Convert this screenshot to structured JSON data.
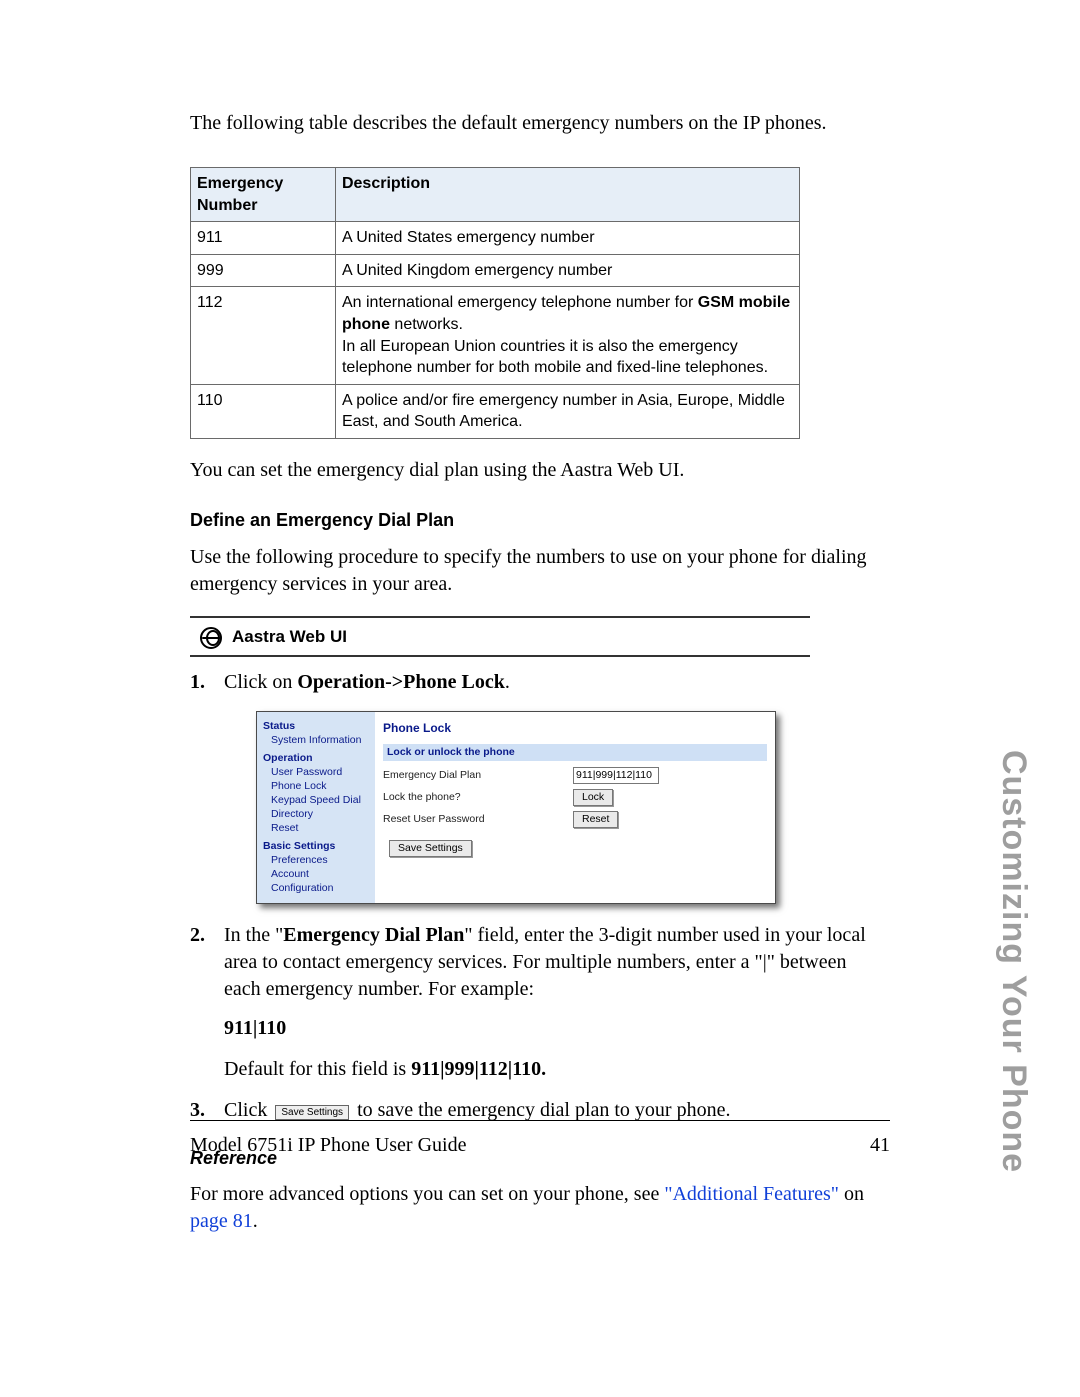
{
  "intro": "The following table describes the default emergency numbers on the IP phones.",
  "table": {
    "head_num": "Emergency Number",
    "head_desc": "Description",
    "rows": [
      {
        "num": "911",
        "desc_pre": "A United States emergency number",
        "bold": "",
        "desc_post": ""
      },
      {
        "num": "999",
        "desc_pre": "A United Kingdom emergency number",
        "bold": "",
        "desc_post": ""
      },
      {
        "num": "112",
        "desc_pre": "An international emergency telephone number for ",
        "bold": "GSM mobile phone",
        "desc_post": " networks.\nIn all European Union countries it is also the emergency telephone number for both mobile and fixed-line telephones."
      },
      {
        "num": "110",
        "desc_pre": "A police and/or fire emergency number in Asia, Europe, Middle East, and South America.",
        "bold": "",
        "desc_post": ""
      }
    ]
  },
  "after_table": "You can set the emergency dial plan using the Aastra Web UI.",
  "section_heading": "Define an Emergency Dial Plan",
  "procedure_intro": "Use the following procedure to specify the numbers to use on your phone for dialing emergency services in your area.",
  "webui_label": "Aastra Web UI",
  "steps": {
    "one_pre": "Click on ",
    "one_bold": "Operation->Phone Lock",
    "one_post": ".",
    "two_pre": "In the \"",
    "two_bold": "Emergency Dial Plan",
    "two_post": "\" field, enter the 3-digit number used in your local area to contact emergency services. For multiple numbers, enter a \"|\" between each emergency number. For example:",
    "example": "911|110",
    "default_pre": "Default for this field is ",
    "default_bold": "911|999|112|110.",
    "three_pre": "Click ",
    "three_btn": "Save Settings",
    "three_post": " to save the emergency dial plan to your phone."
  },
  "sidebar": {
    "status": "Status",
    "system_info": "System Information",
    "operation": "Operation",
    "user_password": "User Password",
    "phone_lock": "Phone Lock",
    "keypad_speed_dial": "Keypad Speed Dial",
    "directory": "Directory",
    "reset": "Reset",
    "basic_settings": "Basic Settings",
    "preferences": "Preferences",
    "account_config": "Account Configuration"
  },
  "phone_lock": {
    "title": "Phone Lock",
    "stripe": "Lock or unlock the phone",
    "row_emergency": "Emergency Dial Plan",
    "row_emergency_value": "911|999|112|110",
    "row_lock": "Lock the phone?",
    "btn_lock": "Lock",
    "row_reset": "Reset User Password",
    "btn_reset": "Reset",
    "btn_save": "Save Settings"
  },
  "reference": {
    "heading": "Reference",
    "pre": "For more advanced options you can set on your phone, see ",
    "link1": "\"Additional Features\"",
    "mid": " on ",
    "link2": "page 81",
    "post": "."
  },
  "side_title": "Customizing Your Phone",
  "footer_left": "Model 6751i IP Phone User Guide",
  "footer_right": "41"
}
